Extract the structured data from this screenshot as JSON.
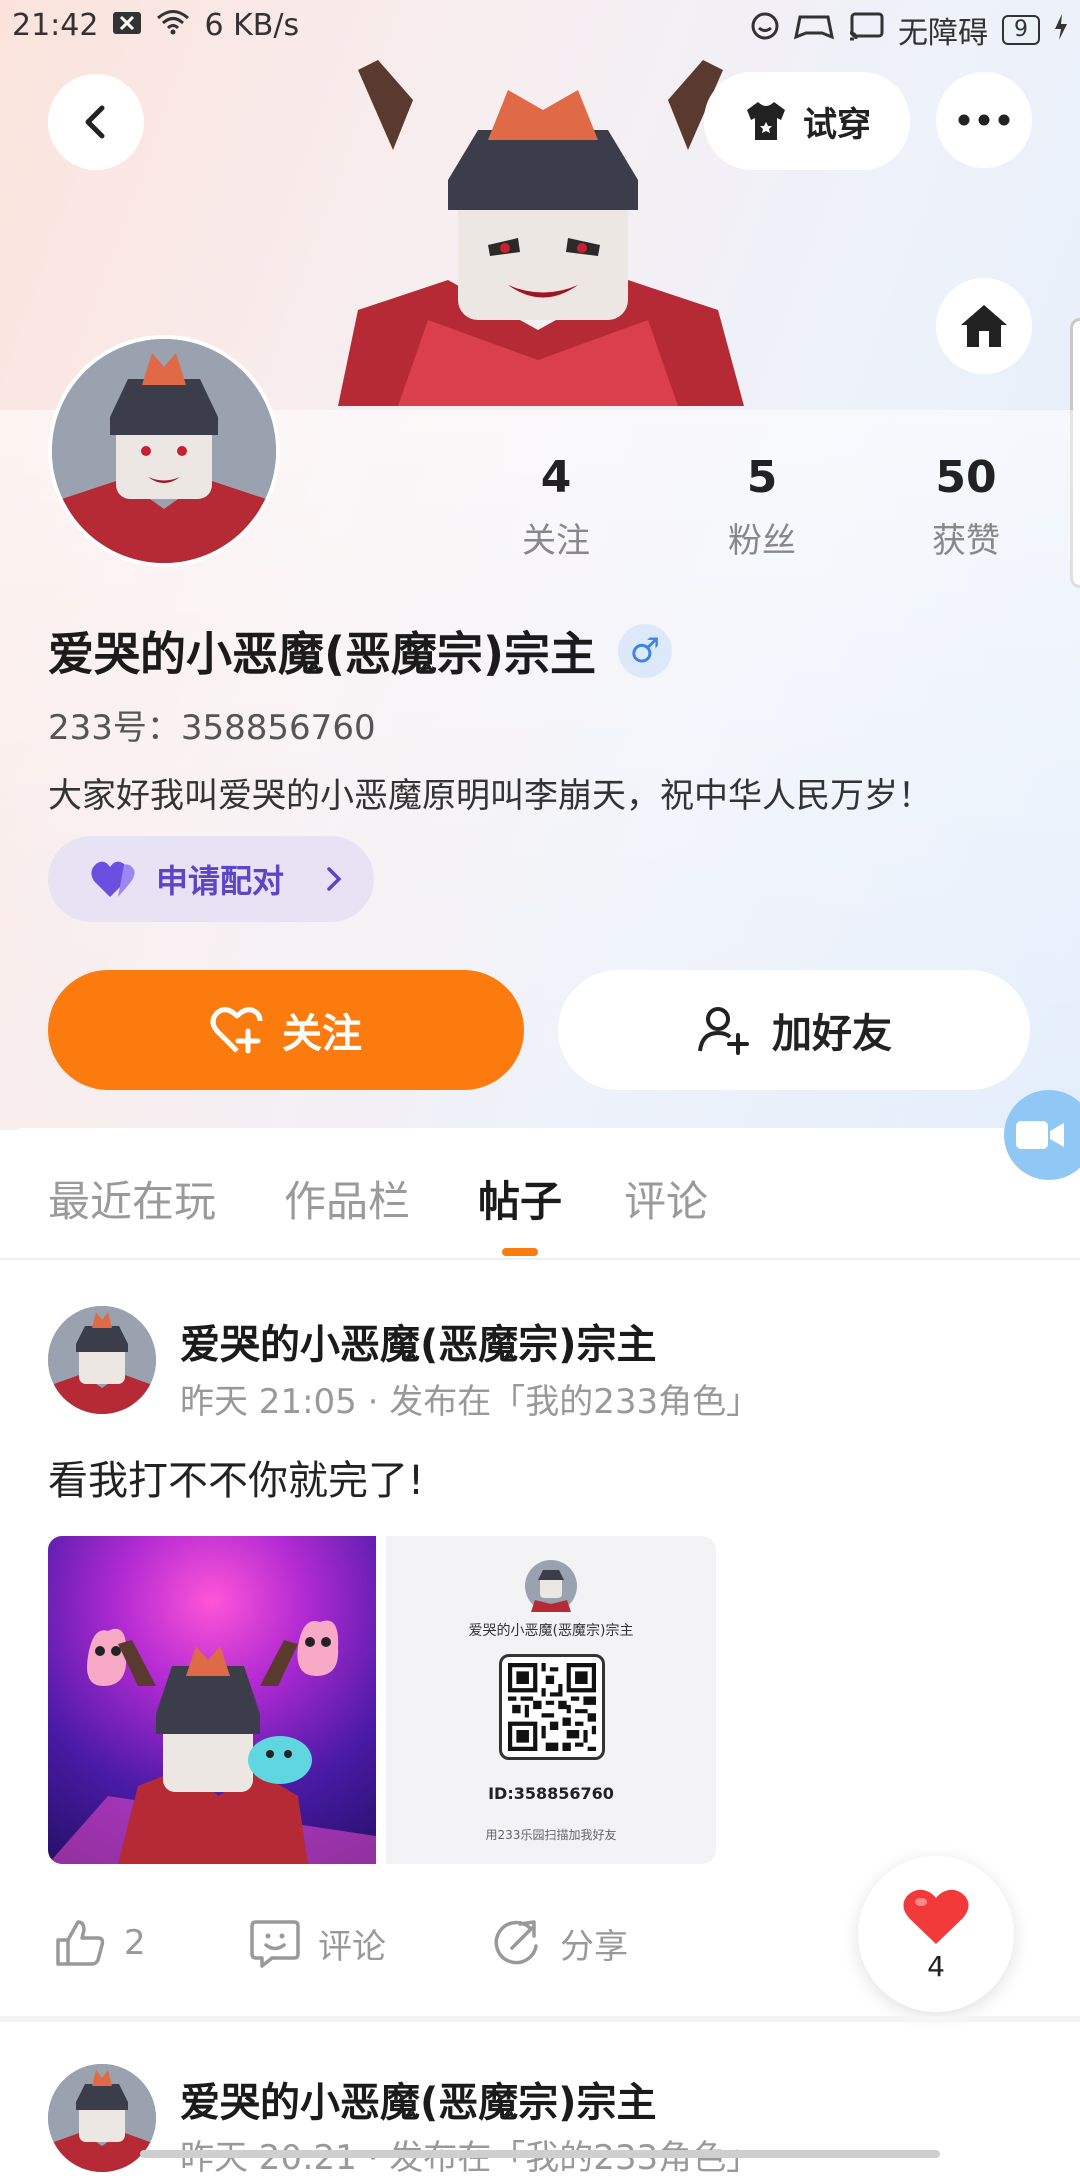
{
  "status_bar": {
    "time": "21:42",
    "net_speed": "6 KB/s",
    "accessibility": "无障碍",
    "battery": "9",
    "icons": [
      "close-box-icon",
      "wifi-icon",
      "record-icon",
      "gamepad-icon",
      "cast-icon",
      "charging-icon"
    ]
  },
  "header": {
    "try_on_label": "试穿",
    "icons": [
      "back-icon",
      "shirt-icon",
      "more-icon",
      "home-icon"
    ]
  },
  "profile": {
    "stats": [
      {
        "num": "4",
        "label": "关注"
      },
      {
        "num": "5",
        "label": "粉丝"
      },
      {
        "num": "50",
        "label": "获赞"
      }
    ],
    "name": "爱哭的小恶魔(恶魔宗)宗主",
    "gender_symbol": "♂",
    "uid": "233号：358856760",
    "bio": "大家好我叫爱哭的小恶魔原明叫李崩天，祝中华人民万岁！",
    "pair_label": "申请配对",
    "follow_label": "关注",
    "add_friend_label": "加好友"
  },
  "tabs": [
    {
      "label": "最近在玩",
      "active": false
    },
    {
      "label": "作品栏",
      "active": false
    },
    {
      "label": "帖子",
      "active": true
    },
    {
      "label": "评论",
      "active": false
    }
  ],
  "posts": [
    {
      "author": "爱哭的小恶魔(恶魔宗)宗主",
      "meta": "昨天 21:05 · 发布在「我的233角色」",
      "text": "看我打不不你就完了!",
      "card": {
        "name": "爱哭的小恶魔(恶魔宗)宗主",
        "id": "ID:358856760",
        "tip": "用233乐园扫描加我好友"
      },
      "likes": "2",
      "comment_label": "评论",
      "share_label": "分享"
    },
    {
      "author": "爱哭的小恶魔(恶魔宗)宗主",
      "meta": "昨天 20:21 · 发布在「我的233角色」"
    }
  ],
  "like_fab": {
    "count": "4"
  },
  "colors": {
    "accent": "#fb7b0f",
    "pair": "#5c46c8",
    "gender": "#3c86e6"
  }
}
